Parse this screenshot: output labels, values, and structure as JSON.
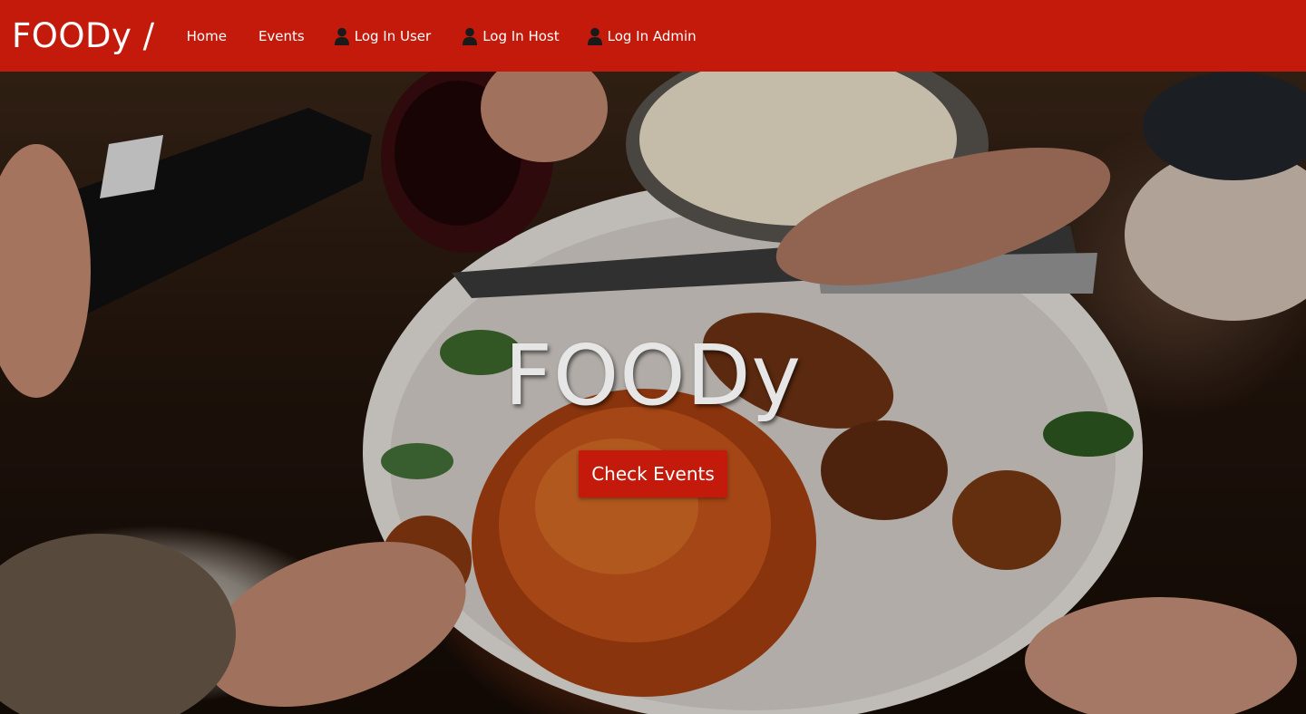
{
  "nav": {
    "brand": "FOODy /",
    "links": [
      {
        "label": "Home"
      },
      {
        "label": "Events"
      },
      {
        "label": "Log In User",
        "icon": "user-icon"
      },
      {
        "label": "Log In Host",
        "icon": "user-icon"
      },
      {
        "label": "Log In Admin",
        "icon": "user-icon"
      }
    ]
  },
  "hero": {
    "title": "FOODy",
    "cta_label": "Check Events",
    "background_image": "table-feast-photo"
  },
  "colors": {
    "brand_red": "#c41a0b",
    "title_text": "#e6e6e6"
  }
}
